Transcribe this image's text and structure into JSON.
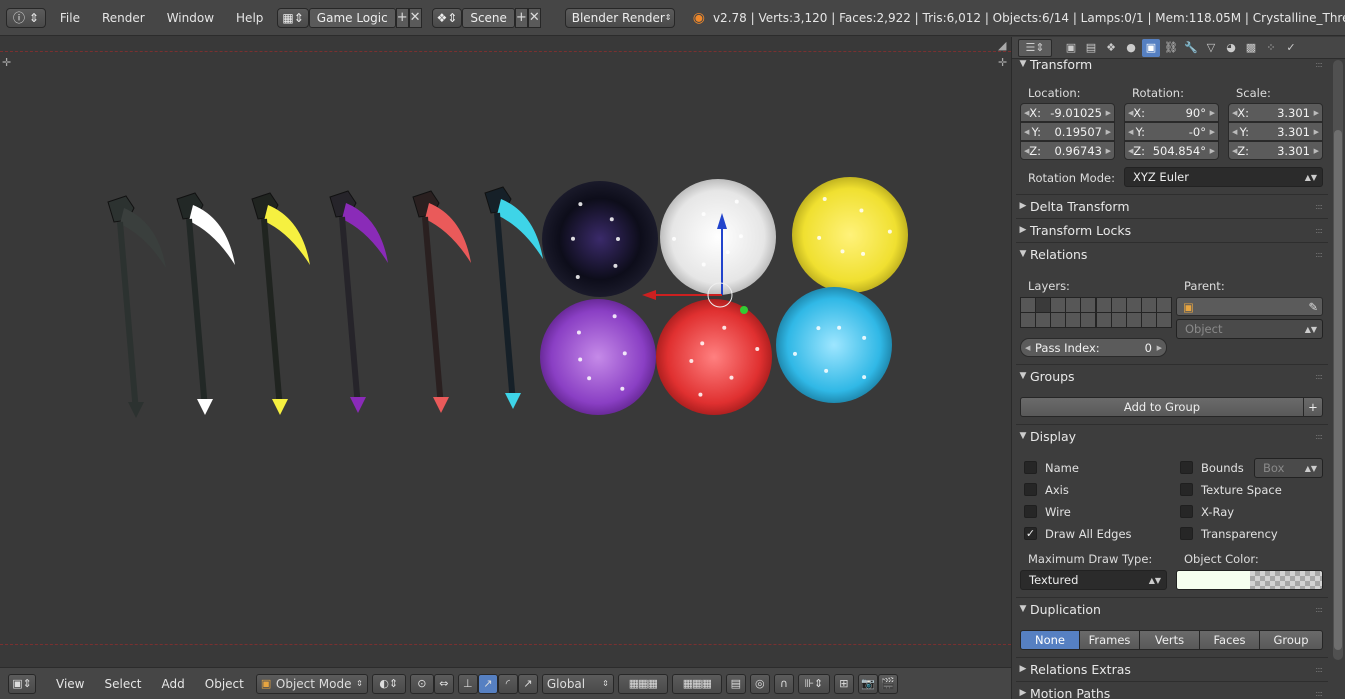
{
  "topbar": {
    "menu": [
      "File",
      "Render",
      "Window",
      "Help"
    ],
    "screen_layout": "Game Logic",
    "scene": "Scene",
    "render_engine": "Blender Render",
    "stats": "v2.78 | Verts:3,120 | Faces:2,922 | Tris:6,012 | Objects:6/14 | Lamps:0/1 | Mem:118.05M | Crystalline_Thres"
  },
  "viewport": {
    "orbs": [
      {
        "color": "#0d0d1a",
        "accent": "#6a3fb5"
      },
      {
        "color": "#ececec",
        "accent": "#ffffff"
      },
      {
        "color": "#f0e030",
        "accent": "#fff27a"
      },
      {
        "color": "#8a3fc4",
        "accent": "#c58ae8"
      },
      {
        "color": "#e03030",
        "accent": "#ff8080"
      },
      {
        "color": "#30b8e6",
        "accent": "#9ee6ff"
      }
    ],
    "scythes": [
      {
        "color": "#2c3230",
        "blade": "#3a3f3d"
      },
      {
        "color": "#222826",
        "blade": "#ffffff"
      },
      {
        "color": "#202420",
        "blade": "#f6f040"
      },
      {
        "color": "#26242a",
        "blade": "#8a2bb8"
      },
      {
        "color": "#2a2020",
        "blade": "#ea5a5a"
      },
      {
        "color": "#162028",
        "blade": "#3ed4e8"
      }
    ]
  },
  "bottombar": {
    "menu": [
      "View",
      "Select",
      "Add",
      "Object"
    ],
    "mode": "Object Mode",
    "orientation": "Global"
  },
  "properties": {
    "transform": {
      "title": "Transform",
      "location_label": "Location:",
      "rotation_label": "Rotation:",
      "scale_label": "Scale:",
      "location": [
        {
          "axis": "X:",
          "value": "-9.01025"
        },
        {
          "axis": "Y:",
          "value": "0.19507"
        },
        {
          "axis": "Z:",
          "value": "0.96743"
        }
      ],
      "rotation": [
        {
          "axis": "X:",
          "value": "90°"
        },
        {
          "axis": "Y:",
          "value": "-0°"
        },
        {
          "axis": "Z:",
          "value": "504.854°"
        }
      ],
      "scale": [
        {
          "axis": "X:",
          "value": "3.301"
        },
        {
          "axis": "Y:",
          "value": "3.301"
        },
        {
          "axis": "Z:",
          "value": "3.301"
        }
      ],
      "rotation_mode_label": "Rotation Mode:",
      "rotation_mode": "XYZ Euler"
    },
    "delta_transform": "Delta Transform",
    "transform_locks": "Transform Locks",
    "relations": {
      "title": "Relations",
      "layers_label": "Layers:",
      "parent_label": "Parent:",
      "parent_type": "Object",
      "pass_index_label": "Pass Index:",
      "pass_index": "0"
    },
    "groups": {
      "title": "Groups",
      "add_to_group": "Add to Group"
    },
    "display": {
      "title": "Display",
      "left": [
        {
          "label": "Name",
          "checked": false
        },
        {
          "label": "Axis",
          "checked": false
        },
        {
          "label": "Wire",
          "checked": false
        },
        {
          "label": "Draw All Edges",
          "checked": true
        }
      ],
      "right": [
        {
          "label": "Bounds",
          "checked": false
        },
        {
          "label": "Texture Space",
          "checked": false
        },
        {
          "label": "X-Ray",
          "checked": false
        },
        {
          "label": "Transparency",
          "checked": false
        }
      ],
      "bounds_type": "Box",
      "max_draw_type_label": "Maximum Draw Type:",
      "max_draw_type": "Textured",
      "object_color_label": "Object Color:",
      "object_color": "#f6fff0"
    },
    "duplication": {
      "title": "Duplication",
      "options": [
        "None",
        "Frames",
        "Verts",
        "Faces",
        "Group"
      ],
      "selected": "None"
    },
    "relations_extras": "Relations Extras",
    "motion_paths": "Motion Paths"
  },
  "colors": {
    "accent": "#5680c2",
    "selected_x_axis": "#cc2020",
    "z_axis": "#2244cc"
  }
}
